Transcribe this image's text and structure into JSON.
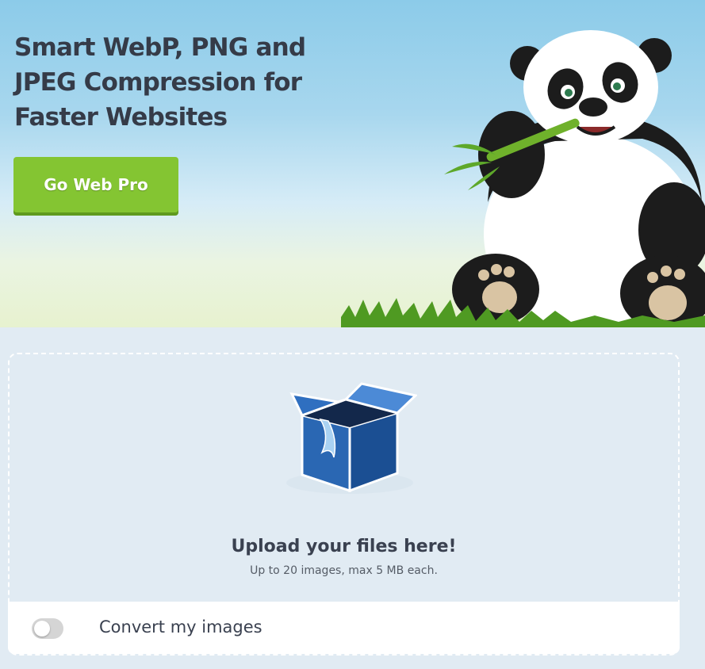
{
  "hero": {
    "title": "Smart WebP, PNG and JPEG Compression for Faster Websites",
    "cta_label": "Go Web Pro",
    "mascot": "panda-eating-bamboo"
  },
  "upload": {
    "icon": "open-box-icon",
    "title": "Upload your files here!",
    "subtitle": "Up to 20 images, max 5 MB each."
  },
  "convert": {
    "label": "Convert my images",
    "enabled": false
  },
  "colors": {
    "cta": "#84c532",
    "sky": "#8ccbe9",
    "upload_bg": "#e1ebf3",
    "text_dark": "#353b48"
  }
}
